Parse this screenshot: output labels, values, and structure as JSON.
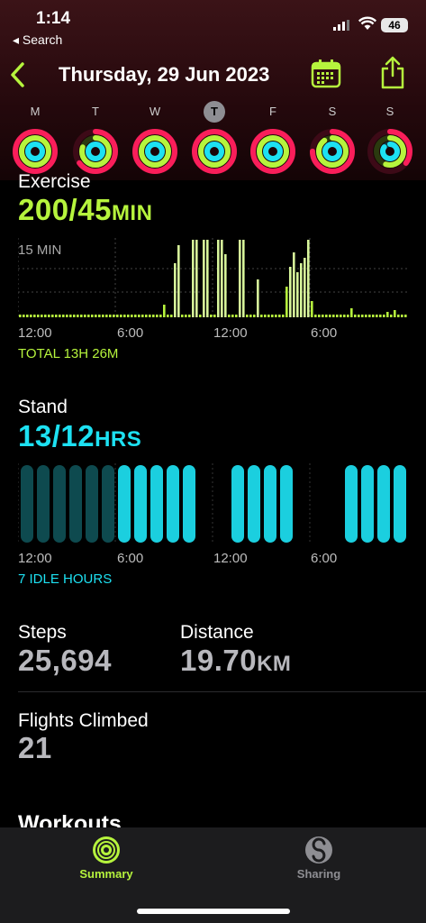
{
  "status_bar": {
    "time": "1:14",
    "back_label": "◂ Search",
    "battery": "46"
  },
  "nav": {
    "title": "Thursday, 29 Jun 2023"
  },
  "week": [
    {
      "letter": "M",
      "selected": false
    },
    {
      "letter": "T",
      "selected": false
    },
    {
      "letter": "W",
      "selected": false
    },
    {
      "letter": "T",
      "selected": true
    },
    {
      "letter": "F",
      "selected": false
    },
    {
      "letter": "S",
      "selected": false
    },
    {
      "letter": "S",
      "selected": false
    }
  ],
  "exercise": {
    "label": "Exercise",
    "value": "200/45",
    "unit": "MIN",
    "scale_label": "15 MIN",
    "axis": [
      "12:00",
      "6:00",
      "12:00",
      "6:00"
    ],
    "total": "TOTAL 13H 26M",
    "color": "#b6f43d"
  },
  "stand": {
    "label": "Stand",
    "value": "13/12",
    "unit": "HRS",
    "axis": [
      "12:00",
      "6:00",
      "12:00",
      "6:00"
    ],
    "idle": "7 IDLE HOURS",
    "color": "#1de1f2"
  },
  "steps": {
    "label": "Steps",
    "value": "25,694"
  },
  "distance": {
    "label": "Distance",
    "value": "19.70",
    "unit": "KM"
  },
  "flights": {
    "label": "Flights Climbed",
    "value": "21"
  },
  "workouts": {
    "label": "Workouts"
  },
  "tabs": [
    {
      "label": "Summary",
      "active": true
    },
    {
      "label": "Sharing",
      "active": false
    }
  ]
}
